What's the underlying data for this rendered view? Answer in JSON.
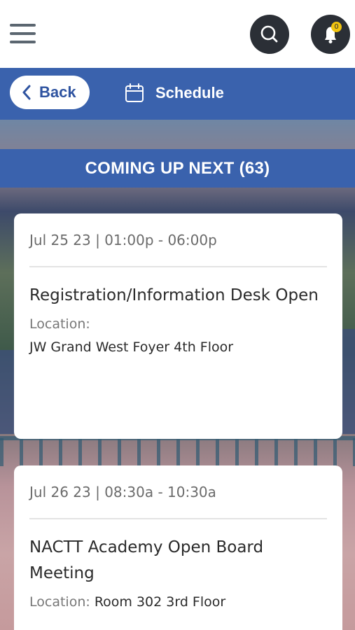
{
  "header": {
    "notification_count": "0",
    "accent": "#3a62ad",
    "dark": "#2b2f36"
  },
  "nav": {
    "back_label": "Back",
    "schedule_label": "Schedule"
  },
  "banner": {
    "label": "COMING UP NEXT (63)"
  },
  "events": [
    {
      "time": "Jul 25 23 | 01:00p - 06:00p",
      "title": "Registration/Information Desk Open",
      "location_label": "Location:",
      "location": "JW Grand West Foyer 4th Floor"
    },
    {
      "time": "Jul 26 23 | 08:30a - 10:30a",
      "title": "NACTT Academy Open Board Meeting",
      "location_label": "Location:",
      "location": "Room 302 3rd Floor"
    }
  ]
}
